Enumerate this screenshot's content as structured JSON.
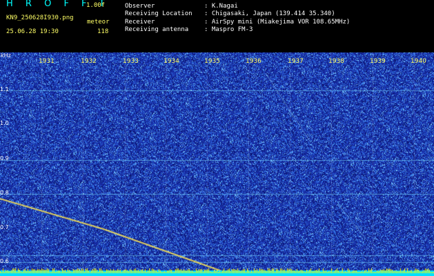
{
  "header": {
    "brand": "H R O F F T",
    "version": "1.00f",
    "filename": "KN9_250628I930.png",
    "mode": "meteor",
    "datetime": "25.06.28 19:30",
    "count": "118",
    "fields": [
      {
        "label": "Observer",
        "value": ": K.Nagai"
      },
      {
        "label": "Receiving Location",
        "value": ": Chigasaki, Japan (139.414 35.340)"
      },
      {
        "label": "Receiver",
        "value": ": AirSpy mini (Miakejima VOR 108.65MHz)"
      },
      {
        "label": "Receiving antenna",
        "value": ": Maspro FM-3"
      }
    ]
  },
  "spectrogram": {
    "unit_label": "kHz",
    "y_ticks": [
      "1.1",
      "1.0",
      "0.9",
      "0.8",
      "0.7",
      "0.6"
    ],
    "x_ticks": [
      "1931",
      "1932",
      "1933",
      "1934",
      "1935",
      "1936",
      "1937",
      "1938",
      "1939",
      "1940"
    ],
    "colors": {
      "background": "#1a2fa8",
      "noise": "#3a7fe0",
      "signal": "#ffff00",
      "baseline": "#00e0ff"
    }
  }
}
